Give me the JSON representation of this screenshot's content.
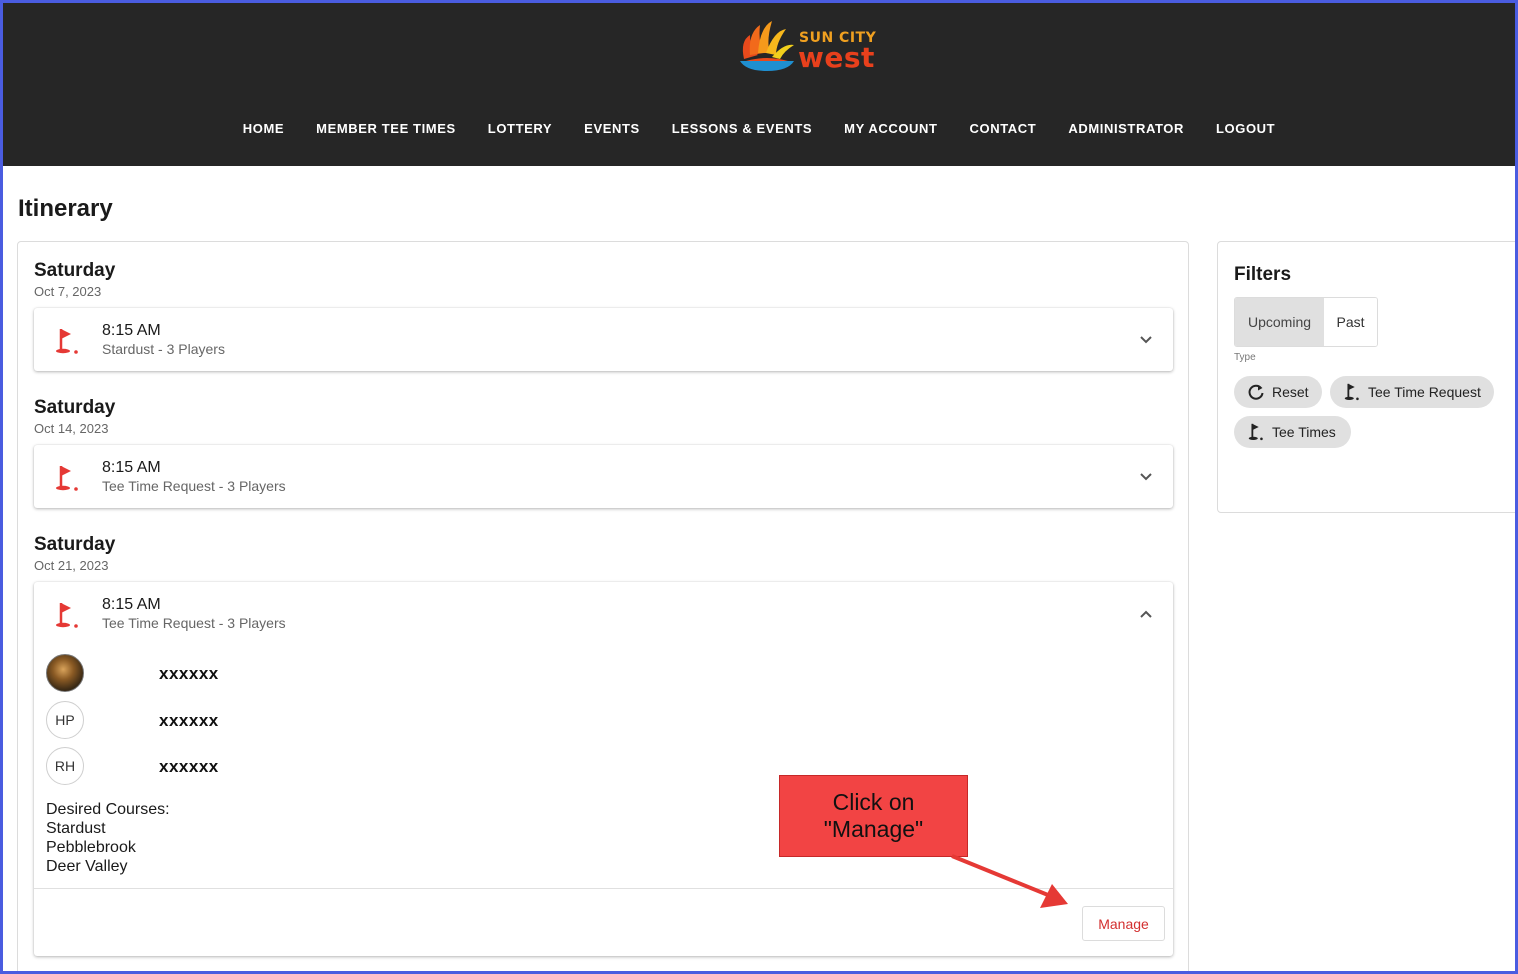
{
  "brand": {
    "line1": "SUN CITY",
    "line2": "west"
  },
  "nav": [
    "HOME",
    "MEMBER TEE TIMES",
    "LOTTERY",
    "EVENTS",
    "LESSONS & EVENTS",
    "MY ACCOUNT",
    "CONTACT",
    "ADMINISTRATOR",
    "LOGOUT"
  ],
  "page": {
    "title": "Itinerary"
  },
  "days": [
    {
      "day": "Saturday",
      "date": "Oct 7, 2023",
      "time": "8:15 AM",
      "subtitle": "Stardust - 3 Players"
    },
    {
      "day": "Saturday",
      "date": "Oct 14, 2023",
      "time": "8:15 AM",
      "subtitle": "Tee Time Request - 3 Players"
    },
    {
      "day": "Saturday",
      "date": "Oct 21, 2023",
      "time": "8:15 AM",
      "subtitle": "Tee Time Request - 3 Players"
    }
  ],
  "expanded": {
    "players": [
      {
        "initials": "",
        "name": "xxxxxx"
      },
      {
        "initials": "HP",
        "name": "xxxxxx"
      },
      {
        "initials": "RH",
        "name": "xxxxxx"
      }
    ],
    "courses_label": "Desired Courses:",
    "courses": [
      "Stardust",
      "Pebblebrook",
      "Deer Valley"
    ],
    "manage_label": "Manage"
  },
  "callout": {
    "line1": "Click on",
    "line2": "\"Manage\""
  },
  "filters": {
    "title": "Filters",
    "segments": [
      "Upcoming",
      "Past"
    ],
    "active_segment": "Upcoming",
    "type_label": "Type",
    "chips": [
      "Reset",
      "Tee Time Request",
      "Tee Times"
    ]
  },
  "colors": {
    "header_bg": "#262626",
    "accent_red": "#d32f2f",
    "callout": "#f24444"
  }
}
